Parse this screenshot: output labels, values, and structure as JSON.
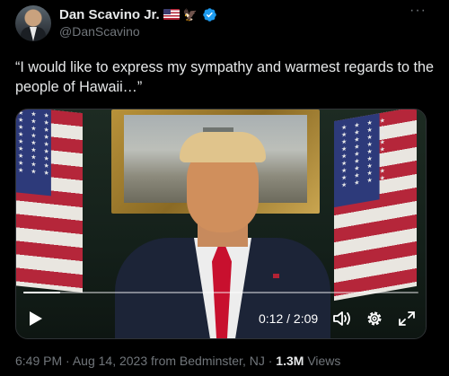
{
  "author": {
    "name": "Dan Scavino Jr.",
    "handle": "@DanScavino",
    "name_emojis": [
      "us-flag-emoji",
      "eagle-emoji"
    ],
    "verified": true
  },
  "more_label": "···",
  "tweet_text": "“I would like to express my sympathy and warmest regards to the people of Hawaii…”",
  "video": {
    "time": "0:12 / 2:09",
    "progress": 0.093,
    "controls": [
      "play-icon",
      "volume-icon",
      "settings-gear-icon",
      "fullscreen-icon"
    ]
  },
  "meta": {
    "time": "6:49 PM",
    "date": "Aug 14, 2023",
    "location": "from Bedminster, NJ",
    "separator": "·",
    "views_count": "1.3M",
    "views_label": "Views"
  },
  "colors": {
    "background": "#000000",
    "text": "#e7e9ea",
    "secondary": "#71767b",
    "verified": "#1d9bf0"
  }
}
